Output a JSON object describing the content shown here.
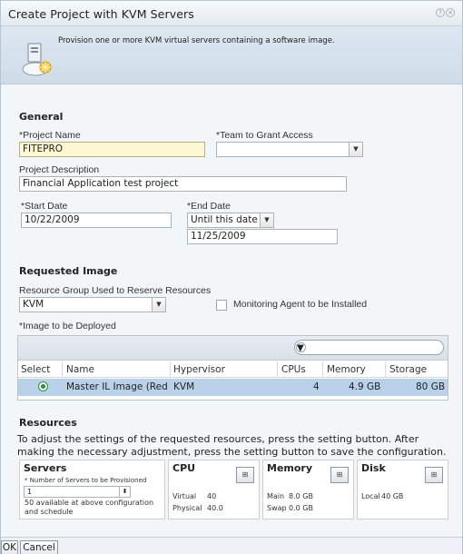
{
  "dialog": {
    "title": "Create Project with KVM Servers",
    "description": "Provision one or more KVM virtual servers containing a software image."
  },
  "general": {
    "heading": "General",
    "project_name_label": "*Project Name",
    "project_name_value": "FITEPRO",
    "team_label": "*Team to Grant Access",
    "team_value": "",
    "description_label": "Project Description",
    "description_value": "Financial Application test project",
    "start_date_label": "*Start Date",
    "start_date_value": "10/22/2009",
    "end_date_label": "*End Date",
    "end_date_mode": "Until this date",
    "end_date_value": "11/25/2009"
  },
  "image": {
    "heading": "Requested Image",
    "resource_group_label": "Resource Group Used to Reserve Resources",
    "resource_group_value": "KVM",
    "monitoring_label": "Monitoring Agent to be Installed",
    "monitoring_checked": false,
    "image_label": "*Image to be Deployed",
    "filter_value": "",
    "columns": [
      "Select",
      "Name",
      "Hypervisor",
      "CPUs",
      "Memory",
      "Storage"
    ],
    "rows": [
      {
        "name": "Master IL Image (Red",
        "hypervisor": "KVM",
        "cpus": "4",
        "memory": "4.9 GB",
        "storage": "80 GB",
        "selected": true
      }
    ]
  },
  "resources": {
    "heading": "Resources",
    "paragraph": "To adjust the settings of the requested resources, press the setting button. After making the necessary adjustment, press the setting button to save the configuration.",
    "servers": {
      "title": "Servers",
      "count_label": "* Number of Servers to be Provisioned",
      "count_value": "1",
      "availability": "50 available at above configuration and schedule"
    },
    "cpu": {
      "title": "CPU",
      "virtual_label": "Virtual",
      "virtual_value": "40",
      "physical_label": "Physical",
      "physical_value": "40.0"
    },
    "memory": {
      "title": "Memory",
      "main_label": "Main",
      "main_value": "8.0 GB",
      "swap_label": "Swap",
      "swap_value": "0.0 GB"
    },
    "disk": {
      "title": "Disk",
      "local_label": "Local",
      "local_value": "40 GB"
    }
  },
  "footer": {
    "ok_label": "OK",
    "cancel_label": "Cancel"
  },
  "colors": {
    "selected_row": "#b9d2ea",
    "required_field": "#fdf7d2",
    "banner": "#d6e2ec"
  }
}
